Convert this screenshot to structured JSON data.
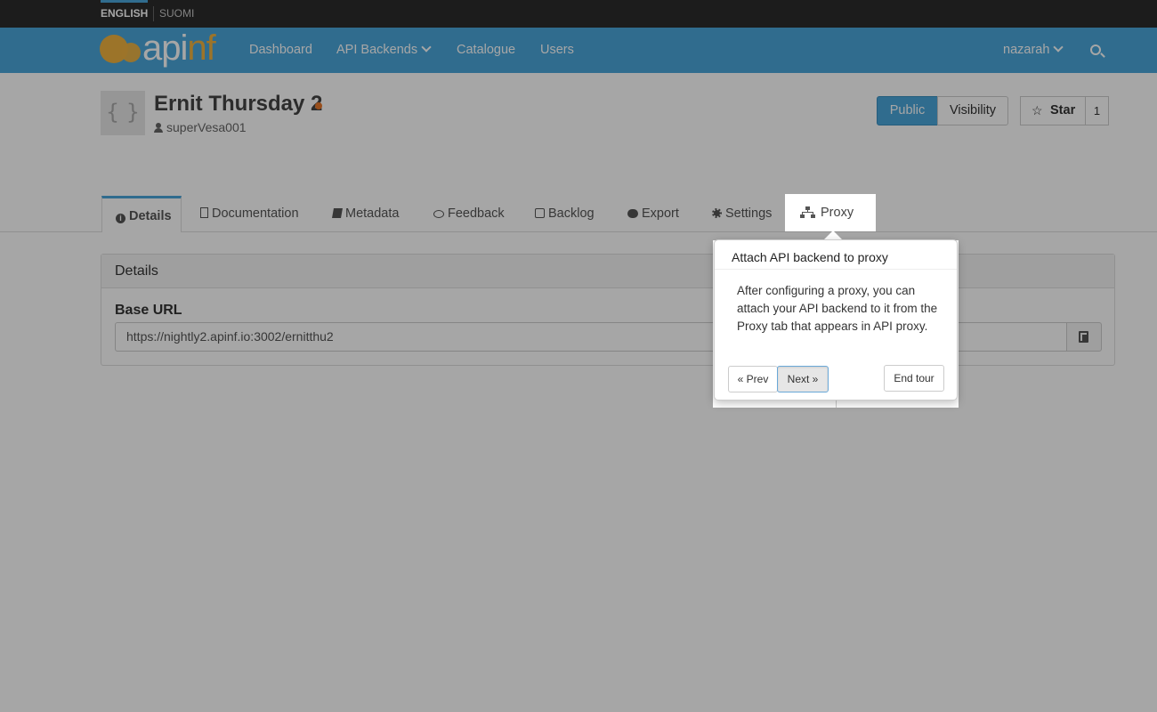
{
  "languages": {
    "english": "ENGLISH",
    "suomi": "SUOMI"
  },
  "brand": {
    "logo_text_white": "api",
    "logo_text_yellow": "nf"
  },
  "nav": {
    "dashboard": "Dashboard",
    "api_backends": "API Backends",
    "catalogue": "Catalogue",
    "users": "Users",
    "user_menu": "nazarah"
  },
  "api": {
    "logo_glyph": "{ }",
    "title": "Ernit Thursday 2",
    "author": "superVesa001"
  },
  "header_buttons": {
    "public": "Public",
    "visibility": "Visibility",
    "star": "Star",
    "star_count": "1"
  },
  "tabs": [
    {
      "label": "Details",
      "icon": "info-icon"
    },
    {
      "label": "Documentation",
      "icon": "document-icon"
    },
    {
      "label": "Metadata",
      "icon": "book-icon"
    },
    {
      "label": "Feedback",
      "icon": "comment-icon"
    },
    {
      "label": "Backlog",
      "icon": "check-square-icon"
    },
    {
      "label": "Export",
      "icon": "cloud-download-icon"
    },
    {
      "label": "Settings",
      "icon": "gear-icon"
    },
    {
      "label": "Proxy",
      "icon": "sitemap-icon"
    }
  ],
  "details": {
    "heading": "Details",
    "base_url_label": "Base URL",
    "base_url": "https://nightly2.apinf.io:3002/ernitthu2"
  },
  "tour": {
    "title": "Attach API backend to proxy",
    "body": "After configuring a proxy, you can attach your API backend to it from the Proxy tab that appears in API proxy.",
    "prev": "« Prev",
    "next": "Next »",
    "end": "End tour"
  },
  "colors": {
    "navbar": "#4aa6da",
    "topbar": "#2b2b2b",
    "accent_yellow": "#f0b340",
    "status_dot": "#e8792b"
  }
}
